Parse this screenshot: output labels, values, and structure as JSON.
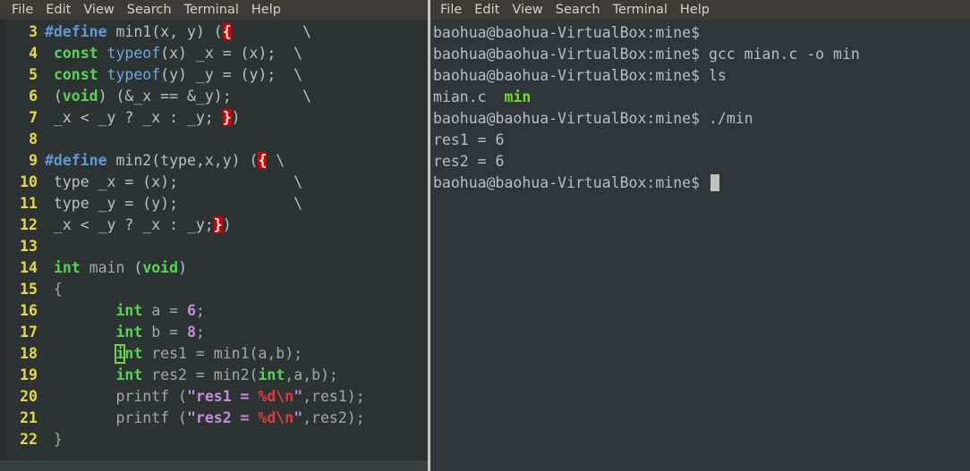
{
  "editor": {
    "menubar": [
      "File",
      "Edit",
      "View",
      "Search",
      "Terminal",
      "Help"
    ],
    "lines": [
      {
        "no": "3",
        "segments": [
          {
            "t": "#define",
            "c": "k-define"
          },
          {
            "t": " min1",
            "c": "k-plain"
          },
          {
            "t": "(x, y) (",
            "c": "k-plain"
          },
          {
            "t": "{",
            "c": "k-brace-hl"
          },
          {
            "t": "        \\",
            "c": "k-cont"
          }
        ]
      },
      {
        "no": "4",
        "segments": [
          {
            "t": " ",
            "c": "k-plain"
          },
          {
            "t": "const",
            "c": "k-kw"
          },
          {
            "t": " ",
            "c": "k-plain"
          },
          {
            "t": "typeof",
            "c": "k-type"
          },
          {
            "t": "(x) _x = (x);  \\",
            "c": "k-plain"
          }
        ]
      },
      {
        "no": "5",
        "segments": [
          {
            "t": " ",
            "c": "k-plain"
          },
          {
            "t": "const",
            "c": "k-kw"
          },
          {
            "t": " ",
            "c": "k-plain"
          },
          {
            "t": "typeof",
            "c": "k-type"
          },
          {
            "t": "(y) _y = (y);  \\",
            "c": "k-plain"
          }
        ]
      },
      {
        "no": "6",
        "segments": [
          {
            "t": " (",
            "c": "k-plain"
          },
          {
            "t": "void",
            "c": "k-kw"
          },
          {
            "t": ") (&_x == &_y);        \\",
            "c": "k-plain"
          }
        ]
      },
      {
        "no": "7",
        "segments": [
          {
            "t": " _x < _y ? _x : _y; ",
            "c": "k-plain"
          },
          {
            "t": "}",
            "c": "k-brace-hl"
          },
          {
            "t": ")",
            "c": "k-plain"
          }
        ]
      },
      {
        "no": "8",
        "segments": []
      },
      {
        "no": "9",
        "segments": [
          {
            "t": "#define",
            "c": "k-define"
          },
          {
            "t": " min2",
            "c": "k-plain"
          },
          {
            "t": "(type,x,y) (",
            "c": "k-plain"
          },
          {
            "t": "{",
            "c": "k-brace-hl"
          },
          {
            "t": " \\",
            "c": "k-cont"
          }
        ]
      },
      {
        "no": "10",
        "segments": [
          {
            "t": " type _x = (x);             \\",
            "c": "k-plain"
          }
        ]
      },
      {
        "no": "11",
        "segments": [
          {
            "t": " type _y = (y);             \\",
            "c": "k-plain"
          }
        ]
      },
      {
        "no": "12",
        "segments": [
          {
            "t": " _x < _y ? _x : _y;",
            "c": "k-plain"
          },
          {
            "t": "}",
            "c": "k-brace-hl"
          },
          {
            "t": ")",
            "c": "k-plain"
          }
        ]
      },
      {
        "no": "13",
        "segments": []
      },
      {
        "no": "14",
        "segments": [
          {
            "t": " ",
            "c": "k-plain"
          },
          {
            "t": "int",
            "c": "k-kw"
          },
          {
            "t": " ",
            "c": "k-plain"
          },
          {
            "t": "main",
            "c": "k-ident"
          },
          {
            "t": " (",
            "c": "k-plain"
          },
          {
            "t": "void",
            "c": "k-kw"
          },
          {
            "t": ")",
            "c": "k-plain"
          }
        ]
      },
      {
        "no": "15",
        "segments": [
          {
            "t": " {",
            "c": "k-ident"
          }
        ]
      },
      {
        "no": "16",
        "segments": [
          {
            "t": "        ",
            "c": "k-plain"
          },
          {
            "t": "int",
            "c": "k-kw"
          },
          {
            "t": " ",
            "c": "k-plain"
          },
          {
            "t": "a",
            "c": "k-ident"
          },
          {
            "t": " ",
            "c": "k-plain"
          },
          {
            "t": "=",
            "c": "k-ident"
          },
          {
            "t": " ",
            "c": "k-plain"
          },
          {
            "t": "6",
            "c": "k-num"
          },
          {
            "t": ";",
            "c": "k-ident"
          }
        ]
      },
      {
        "no": "17",
        "segments": [
          {
            "t": "        ",
            "c": "k-plain"
          },
          {
            "t": "int",
            "c": "k-kw"
          },
          {
            "t": " ",
            "c": "k-plain"
          },
          {
            "t": "b",
            "c": "k-ident"
          },
          {
            "t": " ",
            "c": "k-plain"
          },
          {
            "t": "=",
            "c": "k-ident"
          },
          {
            "t": " ",
            "c": "k-plain"
          },
          {
            "t": "8",
            "c": "k-num"
          },
          {
            "t": ";",
            "c": "k-ident"
          }
        ]
      },
      {
        "no": "18",
        "segments": [
          {
            "t": "        ",
            "c": "k-plain"
          },
          {
            "t": "i",
            "c": "cursor-box"
          },
          {
            "t": "nt",
            "c": "k-kw"
          },
          {
            "t": " ",
            "c": "k-plain"
          },
          {
            "t": "res1 = min1(a,b);",
            "c": "k-ident"
          }
        ]
      },
      {
        "no": "19",
        "segments": [
          {
            "t": "        ",
            "c": "k-plain"
          },
          {
            "t": "int",
            "c": "k-kw"
          },
          {
            "t": " ",
            "c": "k-plain"
          },
          {
            "t": "res2 = min2(",
            "c": "k-ident"
          },
          {
            "t": "int",
            "c": "k-kw"
          },
          {
            "t": ",a,b);",
            "c": "k-ident"
          }
        ]
      },
      {
        "no": "20",
        "segments": [
          {
            "t": "        printf (",
            "c": "k-ident"
          },
          {
            "t": "\"res1 = ",
            "c": "k-str"
          },
          {
            "t": "%d\\n",
            "c": "k-esc"
          },
          {
            "t": "\"",
            "c": "k-str"
          },
          {
            "t": ",res1);",
            "c": "k-ident"
          }
        ]
      },
      {
        "no": "21",
        "segments": [
          {
            "t": "        printf (",
            "c": "k-ident"
          },
          {
            "t": "\"res2 = ",
            "c": "k-str"
          },
          {
            "t": "%d\\n",
            "c": "k-esc"
          },
          {
            "t": "\"",
            "c": "k-str"
          },
          {
            "t": ",res2);",
            "c": "k-ident"
          }
        ]
      },
      {
        "no": "22",
        "segments": [
          {
            "t": " }",
            "c": "k-ident"
          }
        ]
      }
    ]
  },
  "terminal": {
    "menubar": [
      "File",
      "Edit",
      "View",
      "Search",
      "Terminal",
      "Help"
    ],
    "prompt": "baohua@baohua-VirtualBox:mine$",
    "lines": [
      {
        "type": "prompt",
        "prompt": "baohua@baohua-VirtualBox:mine$",
        "command": ""
      },
      {
        "type": "prompt",
        "prompt": "baohua@baohua-VirtualBox:mine$",
        "command": " gcc mian.c -o min"
      },
      {
        "type": "prompt",
        "prompt": "baohua@baohua-VirtualBox:mine$",
        "command": " ls"
      },
      {
        "type": "ls",
        "plain": "mian.c  ",
        "exe": "min"
      },
      {
        "type": "prompt",
        "prompt": "baohua@baohua-VirtualBox:mine$",
        "command": " ./min"
      },
      {
        "type": "output",
        "text": "res1 = 6"
      },
      {
        "type": "output",
        "text": "res2 = 6"
      },
      {
        "type": "prompt-cursor",
        "prompt": "baohua@baohua-VirtualBox:mine$",
        "command": " "
      }
    ]
  },
  "colors": {
    "editor_background": "#2d3233",
    "terminal_background": "#2f3538",
    "menubar_background": "#3c3b37",
    "lineno": "#e6d94a",
    "keyword": "#55d455",
    "preprocessor": "#5f97d6",
    "string": "#c38fd9",
    "escape": "#e03b3b",
    "brace_highlight": "#d40000",
    "cursor": "#7bd14a",
    "executable": "#6ee02a",
    "splitter": "#c7c6bd"
  }
}
